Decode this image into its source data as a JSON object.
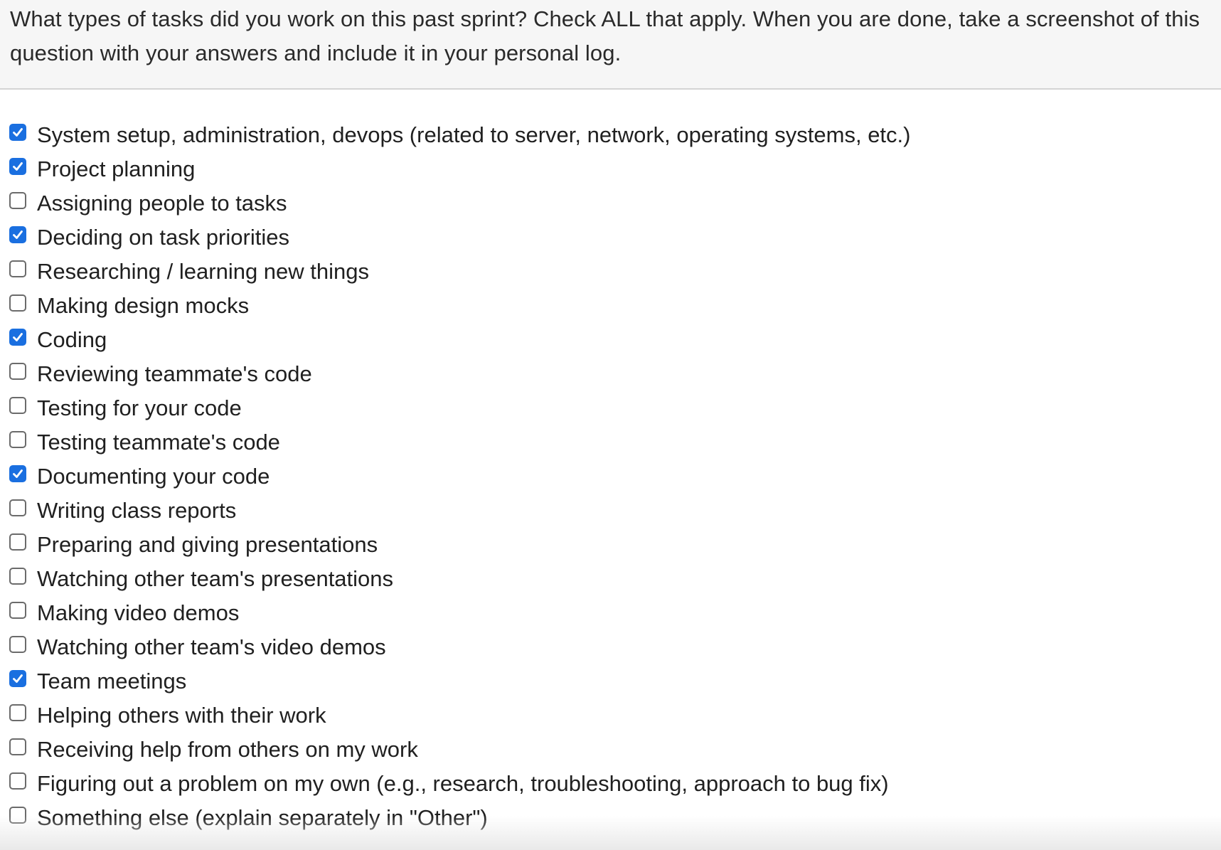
{
  "question": {
    "text": "What types of tasks did you work on this past sprint? Check ALL that apply. When you are done, take a screenshot of this question with your answers and include it in your personal log."
  },
  "colors": {
    "checked": "#1a6fe0",
    "unchecked_border": "#6b6b6b",
    "header_background": "#f6f6f6"
  },
  "options": [
    {
      "label": "System setup, administration, devops (related to server, network, operating systems, etc.)",
      "checked": true
    },
    {
      "label": "Project planning",
      "checked": true
    },
    {
      "label": "Assigning people to tasks",
      "checked": false
    },
    {
      "label": "Deciding on task priorities",
      "checked": true
    },
    {
      "label": "Researching / learning new things",
      "checked": false
    },
    {
      "label": "Making design mocks",
      "checked": false
    },
    {
      "label": "Coding",
      "checked": true
    },
    {
      "label": "Reviewing teammate's code",
      "checked": false
    },
    {
      "label": "Testing for your code",
      "checked": false
    },
    {
      "label": "Testing teammate's code",
      "checked": false
    },
    {
      "label": "Documenting your code",
      "checked": true
    },
    {
      "label": "Writing class reports",
      "checked": false
    },
    {
      "label": "Preparing and giving presentations",
      "checked": false
    },
    {
      "label": "Watching other team's presentations",
      "checked": false
    },
    {
      "label": "Making video demos",
      "checked": false
    },
    {
      "label": "Watching other team's video demos",
      "checked": false
    },
    {
      "label": "Team meetings",
      "checked": true
    },
    {
      "label": "Helping others with their work",
      "checked": false
    },
    {
      "label": "Receiving help from others on my work",
      "checked": false
    },
    {
      "label": "Figuring out a problem on my own (e.g., research, troubleshooting, approach to bug fix)",
      "checked": false
    },
    {
      "label": "Something else (explain separately in \"Other\")",
      "checked": false
    }
  ]
}
